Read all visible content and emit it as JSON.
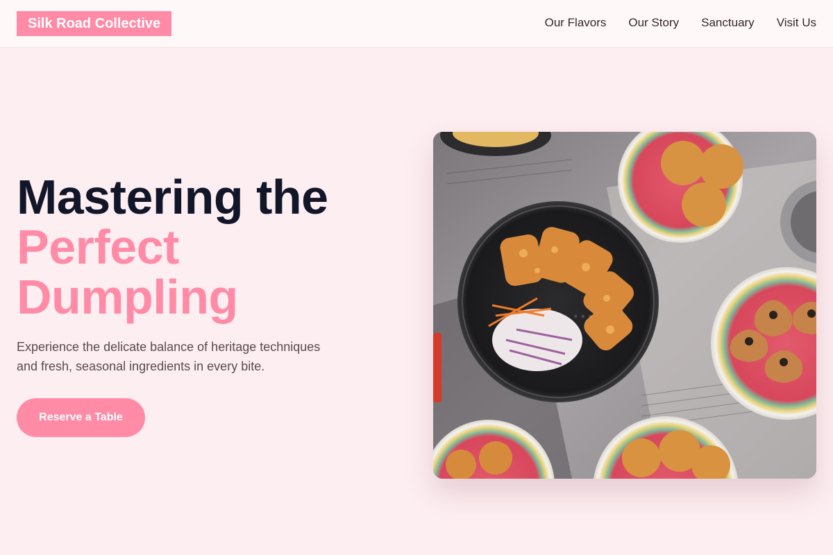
{
  "header": {
    "logo": "Silk Road Collective",
    "nav": [
      {
        "label": "Our Flavors"
      },
      {
        "label": "Our Story"
      },
      {
        "label": "Sanctuary"
      },
      {
        "label": "Visit Us"
      }
    ]
  },
  "hero": {
    "headline_line1": "Mastering the",
    "headline_line2": "Perfect",
    "headline_line3": "Dumpling",
    "subtext": "Experience the delicate balance of heritage techniques and fresh, seasonal ingredients in every bite.",
    "cta_label": "Reserve a Table",
    "image_alt": "Overhead photo of fried dumplings, katsu and slaw on a newspaper-covered table"
  },
  "colors": {
    "accent": "#ff8ba7",
    "headline_dark": "#121629",
    "background": "#fdeef1"
  }
}
